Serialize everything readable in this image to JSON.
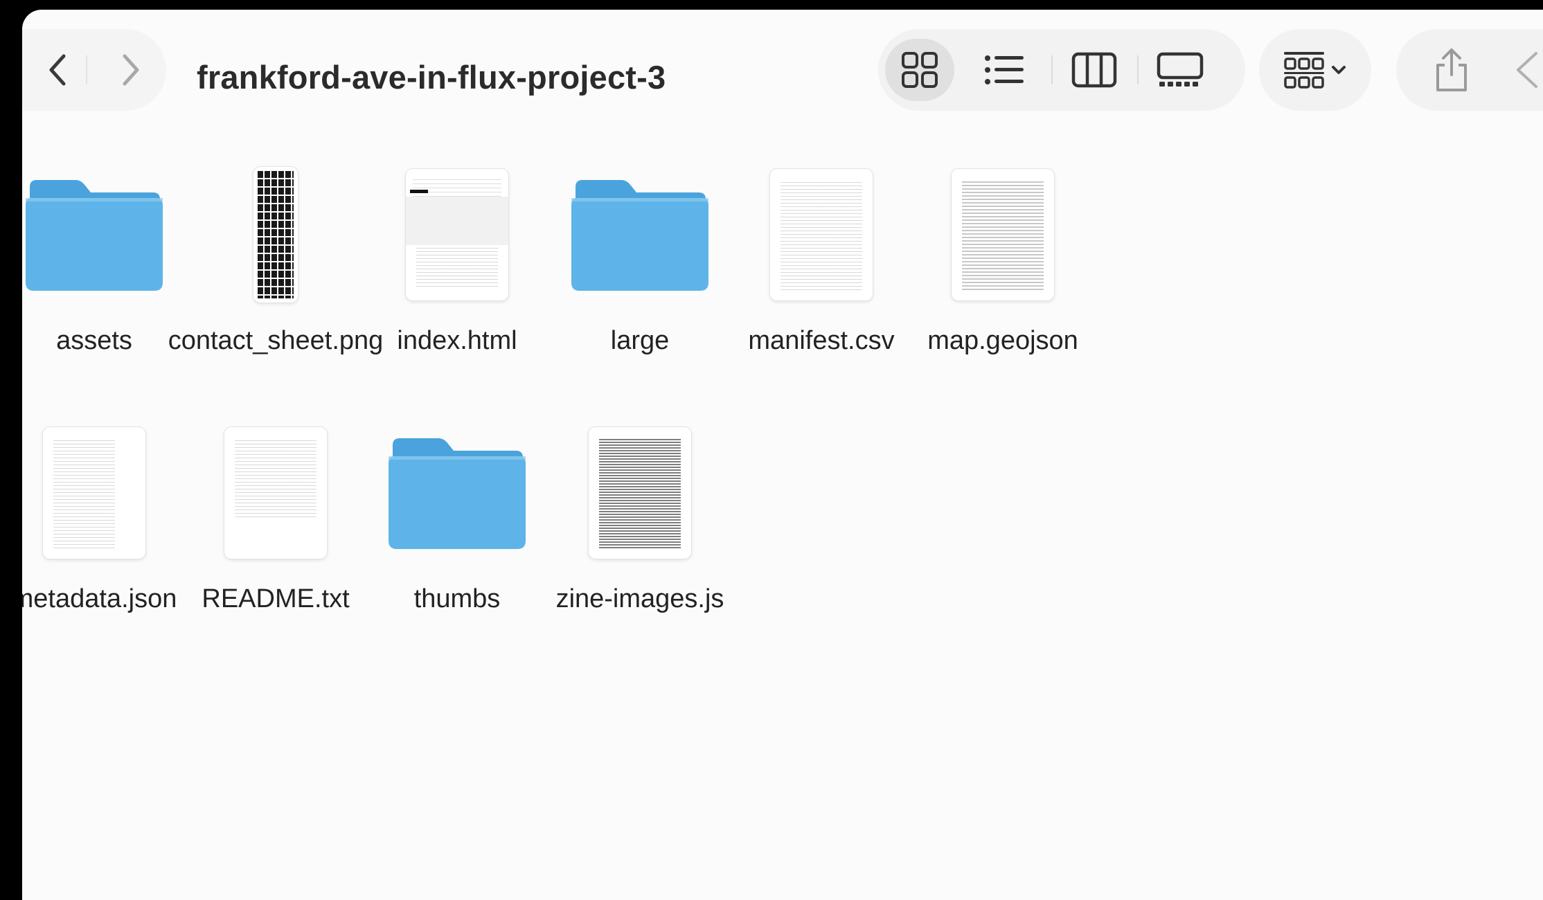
{
  "window": {
    "title": "frankford-ave-in-flux-project-3"
  },
  "toolbar": {
    "back_icon": "chevron-left-icon",
    "forward_icon": "chevron-right-icon",
    "views": [
      "icon-view-icon",
      "list-view-icon",
      "column-view-icon",
      "gallery-view-icon"
    ],
    "active_view": "icon-view-icon",
    "group_icon": "group-grid-icon",
    "share_icon": "share-icon",
    "more_icon": "chevron-left-icon"
  },
  "files": [
    {
      "name": "assets",
      "kind": "folder"
    },
    {
      "name": "contact_sheet.png",
      "kind": "image-strip"
    },
    {
      "name": "index.html",
      "kind": "doc"
    },
    {
      "name": "large",
      "kind": "folder"
    },
    {
      "name": "manifest.csv",
      "kind": "doc"
    },
    {
      "name": "map.geojson",
      "kind": "doc"
    },
    {
      "name": "metadata.json",
      "kind": "doc"
    },
    {
      "name": "README.txt",
      "kind": "doc"
    },
    {
      "name": "thumbs",
      "kind": "folder"
    },
    {
      "name": "zine-images.js",
      "kind": "doc"
    }
  ],
  "colors": {
    "folder_main": "#5eb4e8",
    "folder_tab": "#4aa3dc",
    "window_bg": "#fbfbfb",
    "toolbar_pill": "#f2f2f2"
  }
}
